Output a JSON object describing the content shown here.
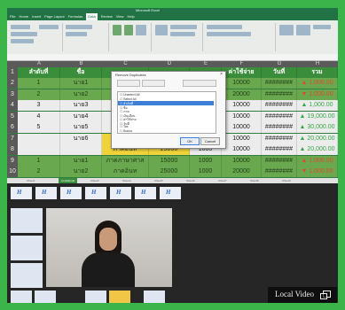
{
  "window": {
    "title": "Microsoft Excel"
  },
  "ribbon": {
    "tabs": [
      "File",
      "Home",
      "Insert",
      "Page Layout",
      "Formulas",
      "Data",
      "Review",
      "View",
      "Help"
    ],
    "active_tab": "Data"
  },
  "sheet": {
    "columns": [
      "A",
      "B",
      "C",
      "D",
      "E",
      "F",
      "G",
      "H"
    ],
    "header_row": {
      "row_num": "1",
      "A": "ลำดับที่",
      "B": "ชื่อ",
      "F": "ค่าใช้จ่าย",
      "G": "วันที่",
      "H": "รวม"
    },
    "rows": [
      {
        "num": "2",
        "A": "1",
        "B": "นาย1",
        "E": "",
        "F": "10000",
        "G": "########",
        "H": "▲ 1,000.00",
        "style": "mid",
        "hcolor": "neg"
      },
      {
        "num": "3",
        "A": "2",
        "B": "นาย2",
        "E": "",
        "F": "20000",
        "G": "########",
        "H": "▼ 1,000.00",
        "style": "mid",
        "hcolor": "neg"
      },
      {
        "num": "4",
        "A": "3",
        "B": "นาย3",
        "E": "",
        "F": "10000",
        "G": "########",
        "H": "▲ 1,000.00",
        "style": "light",
        "hcolor": "pos"
      },
      {
        "num": "5",
        "A": "4",
        "B": "นาย4",
        "E": "",
        "F": "10000",
        "G": "########",
        "H": "▲ 19,000.00",
        "style": "light",
        "hcolor": "pos"
      },
      {
        "num": "6",
        "A": "5",
        "B": "นาย5",
        "E": "",
        "F": "10000",
        "G": "########",
        "H": "▲ 30,000.00",
        "style": "light",
        "hcolor": "pos"
      },
      {
        "num": "7",
        "A": "",
        "B": "นาย6",
        "C": "ภาคอินท",
        "D": "25000",
        "E": "1000",
        "F": "10000",
        "G": "########",
        "H": "▲ 20,000.00",
        "style": "light",
        "hcolor": "pos"
      },
      {
        "num": "8",
        "A": "",
        "B": "",
        "C": "ภาคอินท",
        "D": "25000",
        "E": "1000",
        "F": "10000",
        "G": "########",
        "H": "▲ 20,000.00",
        "style": "light",
        "hcolor": "pos"
      },
      {
        "num": "9",
        "A": "1",
        "B": "นาย1",
        "C": "ภาคภาษาศาส",
        "D": "15000",
        "E": "1000",
        "F": "10000",
        "G": "########",
        "H": "▲ 1,000.00",
        "style": "mid",
        "hcolor": "neg"
      },
      {
        "num": "10",
        "A": "2",
        "B": "นาย2",
        "C": "ภาคอินท",
        "D": "25000",
        "E": "1000",
        "F": "20000",
        "G": "########",
        "H": "▼ 1,000.00",
        "style": "mid",
        "hcolor": "neg"
      }
    ],
    "sheet_tabs": [
      "Sheet1",
      "Conditional",
      "Sheet3",
      "Sheet4",
      "Sheet5",
      "Sheet6",
      "Sheet7",
      "Sheet8",
      "Sheet9"
    ]
  },
  "dialog": {
    "title": "Remove Duplicates",
    "items": [
      "Unselect All",
      "Select All",
      "ลำดับที่",
      "ชื่อ",
      "ภาค",
      "เงินเดือน",
      "ค่าใช้จ่าย",
      "วันที่",
      "Tax",
      "Bonus"
    ],
    "selected_index": 2,
    "ok_label": "OK",
    "cancel_label": "Cancel"
  },
  "video": {
    "local_video_label": "Local Video"
  },
  "colors": {
    "frame": "#3bb54a",
    "header_green": "#3a8d3a",
    "mid_green": "#6aa84f",
    "positive": "#35a845",
    "negative": "#e04a2a"
  }
}
